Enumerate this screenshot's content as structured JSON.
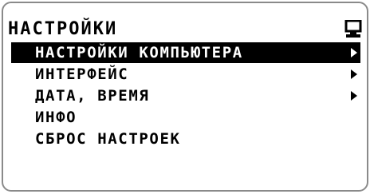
{
  "header": {
    "title": "НАСТРОЙКИ",
    "icon": "screen-icon"
  },
  "menu": {
    "items": [
      {
        "label": "НАСТРОЙКИ КОМПЬЮТЕРА",
        "selected": true,
        "has_submenu": true
      },
      {
        "label": "ИНТЕРФЕЙС",
        "selected": false,
        "has_submenu": true
      },
      {
        "label": "ДАТА, ВРЕМЯ",
        "selected": false,
        "has_submenu": true
      },
      {
        "label": "ИНФО",
        "selected": false,
        "has_submenu": false
      },
      {
        "label": "СБРОС НАСТРОЕК",
        "selected": false,
        "has_submenu": false
      }
    ]
  },
  "colors": {
    "background": "#ffffff",
    "text": "#000000",
    "selection": "#000000",
    "selection_text": "#ffffff",
    "frame": "#8a8a8a"
  }
}
